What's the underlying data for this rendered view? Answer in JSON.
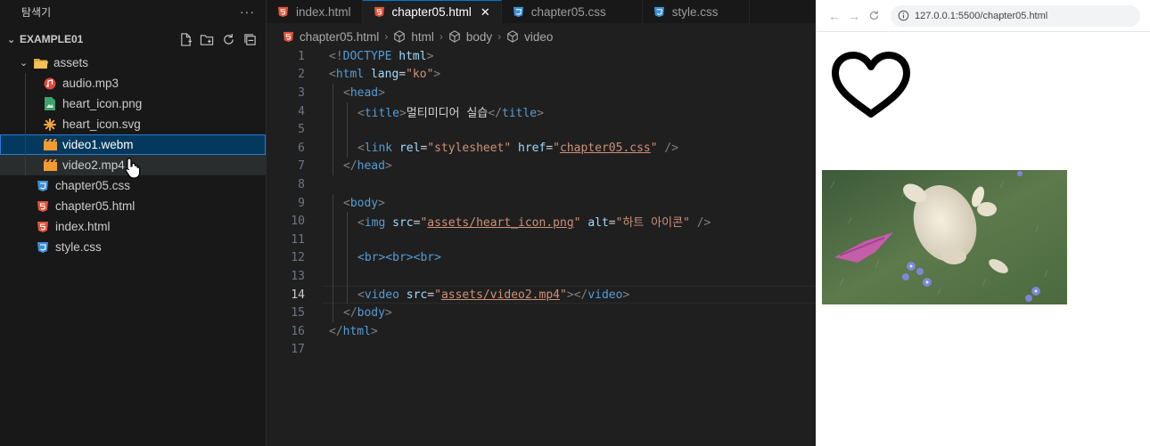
{
  "explorer": {
    "title": "탐색기",
    "more_label": "···",
    "root_label": "EXAMPLE01",
    "items": [
      {
        "label": "assets",
        "kind": "folder"
      },
      {
        "label": "audio.mp3",
        "kind": "audio"
      },
      {
        "label": "heart_icon.png",
        "kind": "image"
      },
      {
        "label": "heart_icon.svg",
        "kind": "svg"
      },
      {
        "label": "video1.webm",
        "kind": "video"
      },
      {
        "label": "video2.mp4",
        "kind": "video"
      },
      {
        "label": "chapter05.css",
        "kind": "css"
      },
      {
        "label": "chapter05.html",
        "kind": "html"
      },
      {
        "label": "index.html",
        "kind": "html"
      },
      {
        "label": "style.css",
        "kind": "css"
      }
    ]
  },
  "editor": {
    "tabs": [
      {
        "label": "index.html",
        "kind": "html"
      },
      {
        "label": "chapter05.html",
        "kind": "html"
      },
      {
        "label": "chapter05.css",
        "kind": "css"
      },
      {
        "label": "style.css",
        "kind": "css"
      }
    ],
    "active_tab": "chapter05.html",
    "breadcrumb": [
      "chapter05.html",
      "html",
      "body",
      "video"
    ],
    "line_numbers": [
      "1",
      "2",
      "3",
      "4",
      "5",
      "6",
      "7",
      "8",
      "9",
      "10",
      "11",
      "12",
      "13",
      "14",
      "15",
      "16",
      "17"
    ],
    "current_line": "14",
    "code": {
      "doctype_open": "<!",
      "doctype_kw": "DOCTYPE",
      "doctype_html": "html",
      "lang_value": "\"ko\"",
      "title_text": "멀티미디어 실습",
      "link_rel_value": "\"stylesheet\"",
      "link_href_value": "chapter05.css",
      "img_src_value": "assets/heart_icon.png",
      "img_alt_value": "\"하트 아이콘\"",
      "video_src_value": "assets/video2.mp4",
      "br_line": "<br><br><br>"
    }
  },
  "browser": {
    "url": "127.0.0.1:5500/chapter05.html"
  },
  "colors": {
    "tag": "#569cd6",
    "attribute": "#9cdcfe",
    "string": "#ce9178",
    "selection": "#04395e",
    "accent": "#0078d4"
  }
}
